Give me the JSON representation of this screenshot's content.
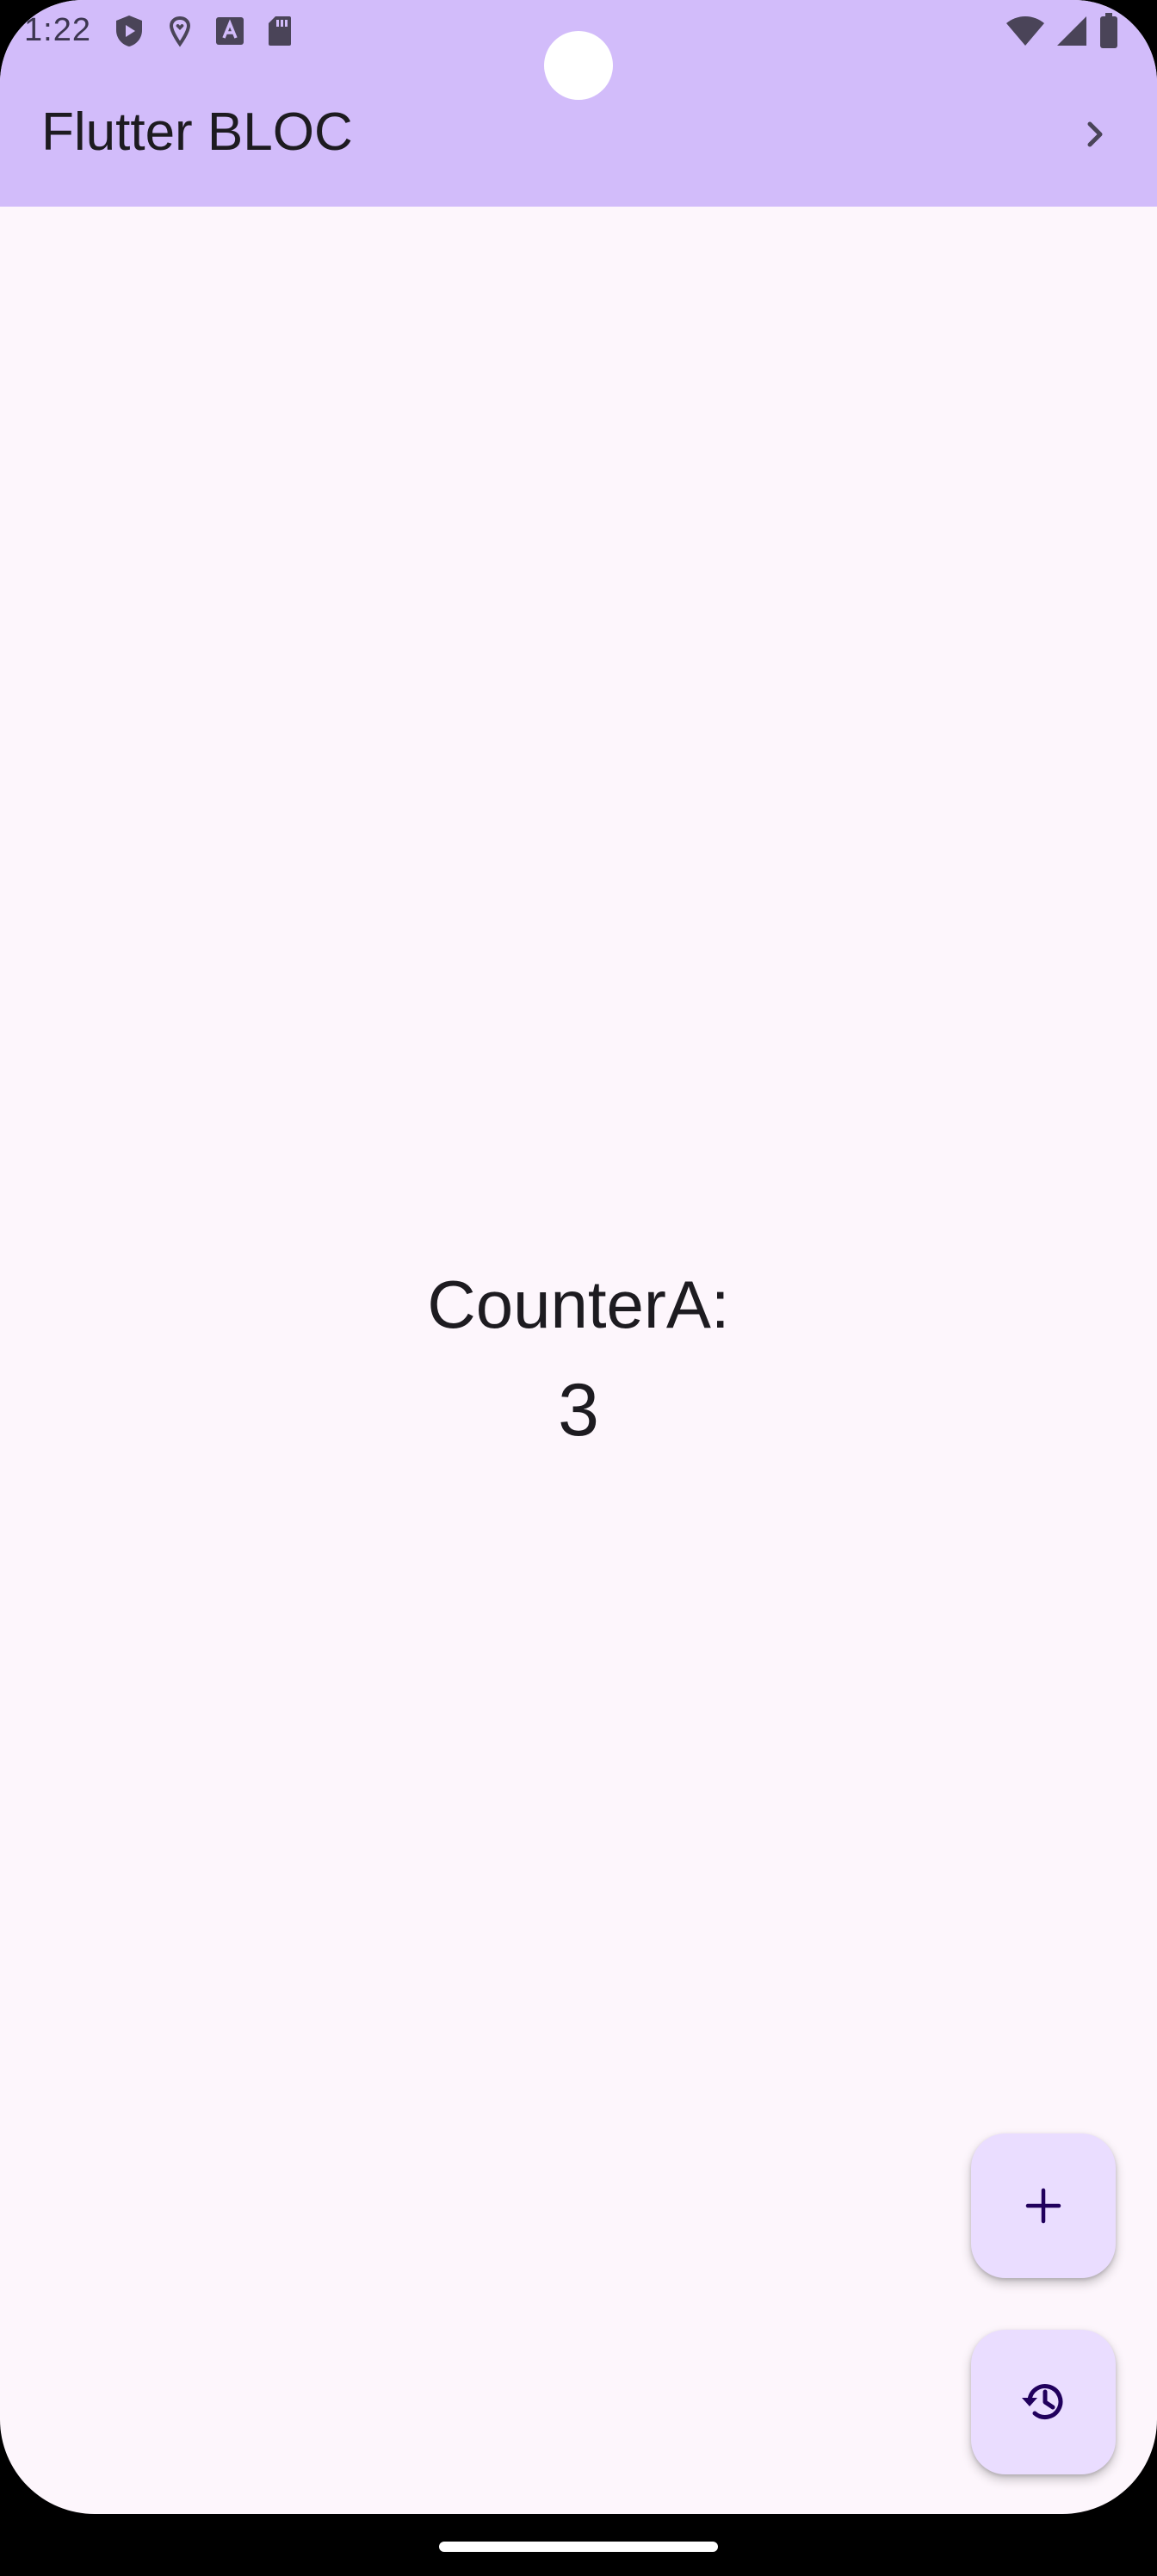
{
  "status_bar": {
    "time": "1:22",
    "left_icons": [
      "shield-play-icon",
      "location-heart-icon",
      "font-a-icon",
      "sd-card-icon"
    ],
    "right_icons": [
      "wifi-icon",
      "cell-signal-icon",
      "battery-icon"
    ]
  },
  "app_bar": {
    "title": "Flutter BLOC",
    "action_icon": "chevron-right-icon"
  },
  "main": {
    "counter_label": "CounterA:",
    "counter_value": "3"
  },
  "fabs": [
    {
      "icon": "add-icon"
    },
    {
      "icon": "history-icon"
    }
  ],
  "colors": {
    "app_bar": "#d2bcfa",
    "background": "#fdf6fc",
    "fab": "#eaddff",
    "on_surface": "#1d1b20",
    "fab_icon": "#21005d"
  }
}
